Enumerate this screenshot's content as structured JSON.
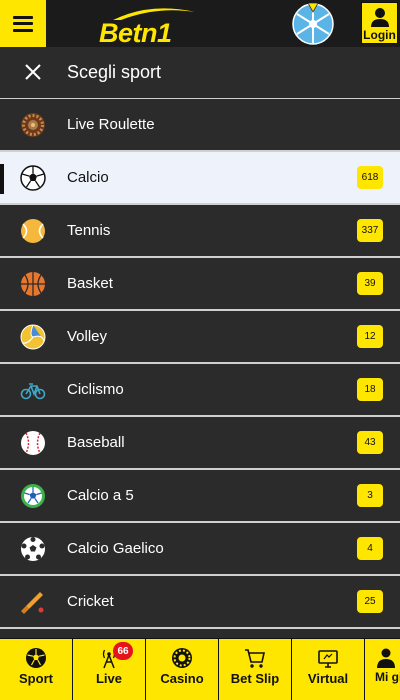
{
  "topbar": {
    "logo_text": "Betn1",
    "login_label": "Login",
    "colors": {
      "brand_yellow": "#ffe600",
      "bar_bg": "#1b1b1b",
      "wheel": "#5ab4e6"
    }
  },
  "header": {
    "title": "Scegli sport"
  },
  "sports": [
    {
      "name": "Live Roulette",
      "count": null,
      "icon": "roulette-icon",
      "active": false
    },
    {
      "name": "Calcio",
      "count": "618",
      "icon": "soccer-ball-icon",
      "active": true
    },
    {
      "name": "Tennis",
      "count": "337",
      "icon": "tennis-ball-icon",
      "active": false
    },
    {
      "name": "Basket",
      "count": "39",
      "icon": "basketball-icon",
      "active": false
    },
    {
      "name": "Volley",
      "count": "12",
      "icon": "volleyball-icon",
      "active": false
    },
    {
      "name": "Ciclismo",
      "count": "18",
      "icon": "bicycle-icon",
      "active": false
    },
    {
      "name": "Baseball",
      "count": "43",
      "icon": "baseball-icon",
      "active": false
    },
    {
      "name": "Calcio a 5",
      "count": "3",
      "icon": "futsal-ball-icon",
      "active": false
    },
    {
      "name": "Calcio Gaelico",
      "count": "4",
      "icon": "gaelic-ball-icon",
      "active": false
    },
    {
      "name": "Cricket",
      "count": "25",
      "icon": "cricket-bat-icon",
      "active": false
    }
  ],
  "bottom_nav": [
    {
      "label": "Sport",
      "icon": "soccer-ball-icon"
    },
    {
      "label": "Live",
      "icon": "broadcast-tower-icon",
      "badge": "66"
    },
    {
      "label": "Casino",
      "icon": "roulette-chip-icon"
    },
    {
      "label": "Bet Slip",
      "icon": "cart-icon"
    },
    {
      "label": "Virtual",
      "icon": "monitor-icon"
    },
    {
      "label": "Mi gioc",
      "icon": "user-icon"
    }
  ]
}
